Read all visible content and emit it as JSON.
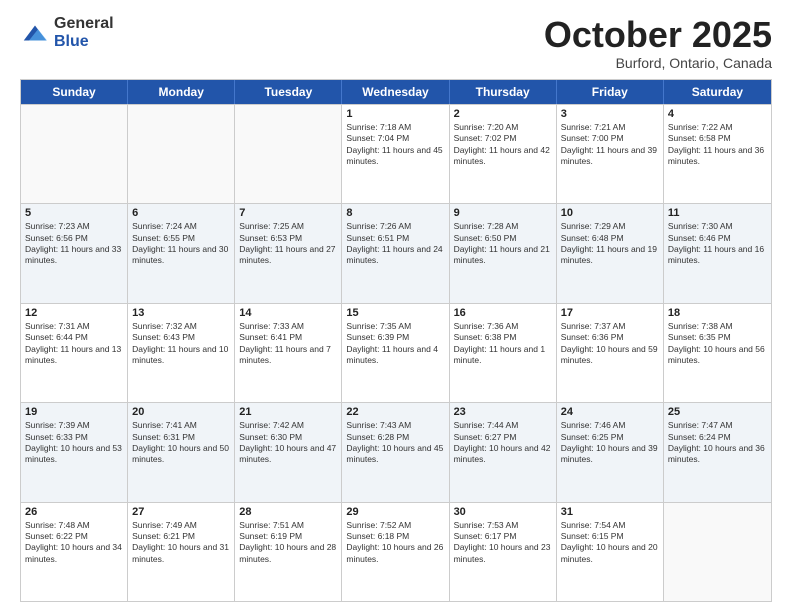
{
  "header": {
    "logo_general": "General",
    "logo_blue": "Blue",
    "month_title": "October 2025",
    "location": "Burford, Ontario, Canada"
  },
  "days_of_week": [
    "Sunday",
    "Monday",
    "Tuesday",
    "Wednesday",
    "Thursday",
    "Friday",
    "Saturday"
  ],
  "weeks": [
    [
      {
        "day": "",
        "info": ""
      },
      {
        "day": "",
        "info": ""
      },
      {
        "day": "",
        "info": ""
      },
      {
        "day": "1",
        "info": "Sunrise: 7:18 AM\nSunset: 7:04 PM\nDaylight: 11 hours and 45 minutes."
      },
      {
        "day": "2",
        "info": "Sunrise: 7:20 AM\nSunset: 7:02 PM\nDaylight: 11 hours and 42 minutes."
      },
      {
        "day": "3",
        "info": "Sunrise: 7:21 AM\nSunset: 7:00 PM\nDaylight: 11 hours and 39 minutes."
      },
      {
        "day": "4",
        "info": "Sunrise: 7:22 AM\nSunset: 6:58 PM\nDaylight: 11 hours and 36 minutes."
      }
    ],
    [
      {
        "day": "5",
        "info": "Sunrise: 7:23 AM\nSunset: 6:56 PM\nDaylight: 11 hours and 33 minutes."
      },
      {
        "day": "6",
        "info": "Sunrise: 7:24 AM\nSunset: 6:55 PM\nDaylight: 11 hours and 30 minutes."
      },
      {
        "day": "7",
        "info": "Sunrise: 7:25 AM\nSunset: 6:53 PM\nDaylight: 11 hours and 27 minutes."
      },
      {
        "day": "8",
        "info": "Sunrise: 7:26 AM\nSunset: 6:51 PM\nDaylight: 11 hours and 24 minutes."
      },
      {
        "day": "9",
        "info": "Sunrise: 7:28 AM\nSunset: 6:50 PM\nDaylight: 11 hours and 21 minutes."
      },
      {
        "day": "10",
        "info": "Sunrise: 7:29 AM\nSunset: 6:48 PM\nDaylight: 11 hours and 19 minutes."
      },
      {
        "day": "11",
        "info": "Sunrise: 7:30 AM\nSunset: 6:46 PM\nDaylight: 11 hours and 16 minutes."
      }
    ],
    [
      {
        "day": "12",
        "info": "Sunrise: 7:31 AM\nSunset: 6:44 PM\nDaylight: 11 hours and 13 minutes."
      },
      {
        "day": "13",
        "info": "Sunrise: 7:32 AM\nSunset: 6:43 PM\nDaylight: 11 hours and 10 minutes."
      },
      {
        "day": "14",
        "info": "Sunrise: 7:33 AM\nSunset: 6:41 PM\nDaylight: 11 hours and 7 minutes."
      },
      {
        "day": "15",
        "info": "Sunrise: 7:35 AM\nSunset: 6:39 PM\nDaylight: 11 hours and 4 minutes."
      },
      {
        "day": "16",
        "info": "Sunrise: 7:36 AM\nSunset: 6:38 PM\nDaylight: 11 hours and 1 minute."
      },
      {
        "day": "17",
        "info": "Sunrise: 7:37 AM\nSunset: 6:36 PM\nDaylight: 10 hours and 59 minutes."
      },
      {
        "day": "18",
        "info": "Sunrise: 7:38 AM\nSunset: 6:35 PM\nDaylight: 10 hours and 56 minutes."
      }
    ],
    [
      {
        "day": "19",
        "info": "Sunrise: 7:39 AM\nSunset: 6:33 PM\nDaylight: 10 hours and 53 minutes."
      },
      {
        "day": "20",
        "info": "Sunrise: 7:41 AM\nSunset: 6:31 PM\nDaylight: 10 hours and 50 minutes."
      },
      {
        "day": "21",
        "info": "Sunrise: 7:42 AM\nSunset: 6:30 PM\nDaylight: 10 hours and 47 minutes."
      },
      {
        "day": "22",
        "info": "Sunrise: 7:43 AM\nSunset: 6:28 PM\nDaylight: 10 hours and 45 minutes."
      },
      {
        "day": "23",
        "info": "Sunrise: 7:44 AM\nSunset: 6:27 PM\nDaylight: 10 hours and 42 minutes."
      },
      {
        "day": "24",
        "info": "Sunrise: 7:46 AM\nSunset: 6:25 PM\nDaylight: 10 hours and 39 minutes."
      },
      {
        "day": "25",
        "info": "Sunrise: 7:47 AM\nSunset: 6:24 PM\nDaylight: 10 hours and 36 minutes."
      }
    ],
    [
      {
        "day": "26",
        "info": "Sunrise: 7:48 AM\nSunset: 6:22 PM\nDaylight: 10 hours and 34 minutes."
      },
      {
        "day": "27",
        "info": "Sunrise: 7:49 AM\nSunset: 6:21 PM\nDaylight: 10 hours and 31 minutes."
      },
      {
        "day": "28",
        "info": "Sunrise: 7:51 AM\nSunset: 6:19 PM\nDaylight: 10 hours and 28 minutes."
      },
      {
        "day": "29",
        "info": "Sunrise: 7:52 AM\nSunset: 6:18 PM\nDaylight: 10 hours and 26 minutes."
      },
      {
        "day": "30",
        "info": "Sunrise: 7:53 AM\nSunset: 6:17 PM\nDaylight: 10 hours and 23 minutes."
      },
      {
        "day": "31",
        "info": "Sunrise: 7:54 AM\nSunset: 6:15 PM\nDaylight: 10 hours and 20 minutes."
      },
      {
        "day": "",
        "info": ""
      }
    ]
  ]
}
